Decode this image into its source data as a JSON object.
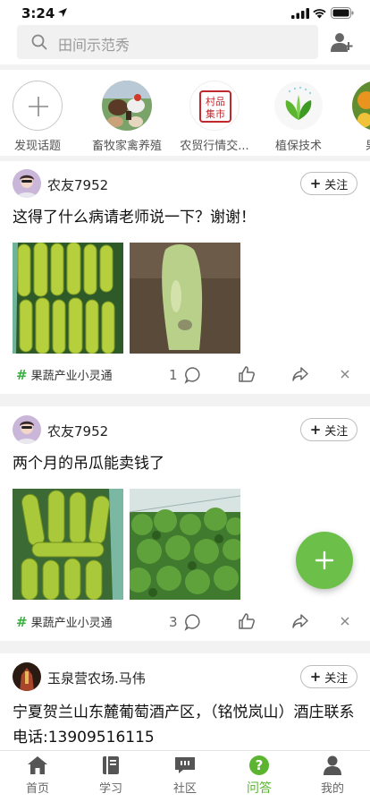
{
  "status_bar": {
    "time": "3:24"
  },
  "search": {
    "placeholder": "田间示范秀"
  },
  "topics": [
    {
      "label": "发现话题"
    },
    {
      "label": "畜牧家禽养殖"
    },
    {
      "label": "农贸行情交...",
      "logo_text": "村品集市"
    },
    {
      "label": "植保技术"
    },
    {
      "label": "果蔬"
    }
  ],
  "posts": [
    {
      "username": "农友7952",
      "follow_label": "关注",
      "text": "这得了什么病请老师说一下？谢谢！",
      "tag": "果蔬产业小灵通",
      "comment_count": "1"
    },
    {
      "username": "农友7952",
      "follow_label": "关注",
      "text": "两个月的吊瓜能卖钱了",
      "tag": "果蔬产业小灵通",
      "comment_count": "3"
    },
    {
      "username": "玉泉营农场.马伟",
      "follow_label": "关注",
      "text": "宁夏贺兰山东麓葡萄酒产区，（铭悦岚山）酒庄联系电话:13909516115"
    }
  ],
  "tabs": [
    {
      "label": "首页",
      "icon": "home-icon"
    },
    {
      "label": "学习",
      "icon": "book-icon"
    },
    {
      "label": "社区",
      "icon": "chat-icon"
    },
    {
      "label": "问答",
      "icon": "question-icon",
      "active": true
    },
    {
      "label": "我的",
      "icon": "person-icon"
    }
  ],
  "colors": {
    "accent": "#5cb531",
    "fab": "#6cc04a",
    "hash": "#3cb043"
  }
}
